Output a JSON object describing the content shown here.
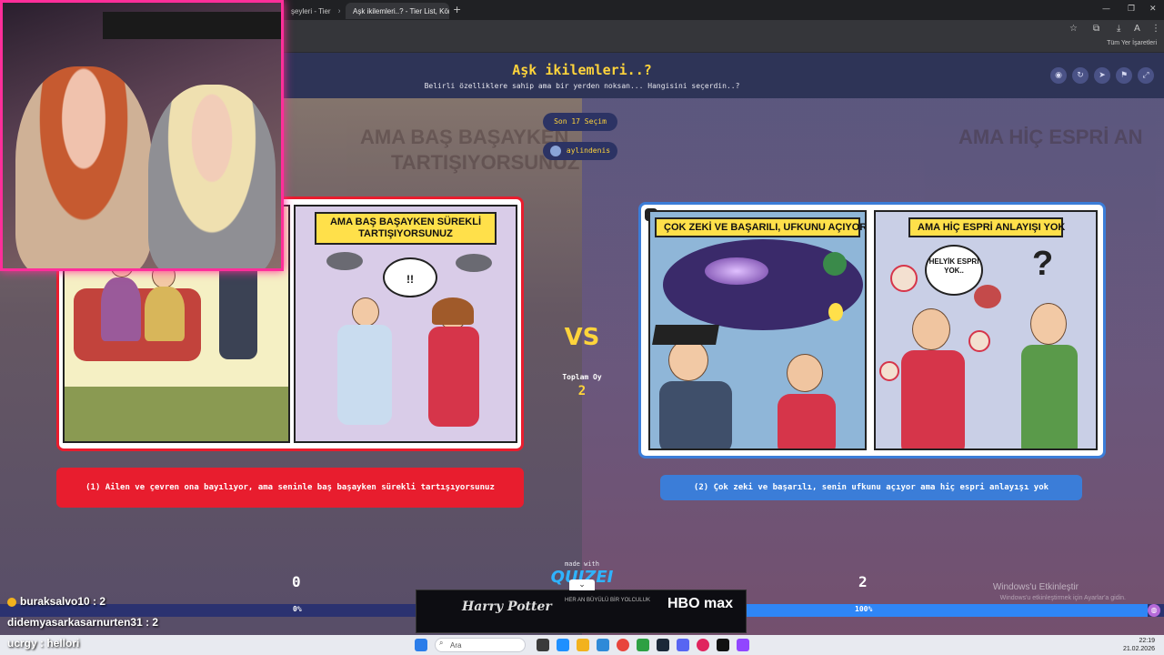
{
  "browser": {
    "tabs": [
      {
        "label": "şeyleri - Tier",
        "active": false
      },
      {
        "label": "Aşk ikilemleri..? - Tier List, Kör",
        "active": true
      }
    ],
    "new_tab": "+",
    "bookmarks_label": "Tüm Yer İşaretleri"
  },
  "page": {
    "title": "Aşk ikilemleri..?",
    "subtitle": "Belirli özelliklere sahip ama bir yerden noksan... Hangisini seçerdin..?",
    "last_choices_pill": "Son 17 Seçim",
    "username_pill": "aylindenis",
    "background_text_left": "AMA BAŞ BAŞAYKEN",
    "background_text_left2": "TARTIŞIYORSUNUZ",
    "background_text_right": "AMA HİÇ ESPRİ AN",
    "vs_label": "VS",
    "total_votes_label": "Toplam Oy",
    "total_votes_value": "2"
  },
  "left_option": {
    "panel2_caption_line1": "AMA BAŞ BAŞAYKEN SÜREKLİ",
    "panel2_caption_line2": "TARTIŞIYORSUNUZ",
    "panel1_bubble": "...",
    "panel2_bubble": "!!",
    "answer_text": "(1) Ailen ve çevren ona bayılıyor, ama seninle baş başayken sürekli tartışıyorsunuz",
    "vote_count": "0",
    "percent": "0%"
  },
  "right_option": {
    "panel1_caption": "ÇOK ZEKİ VE BAŞARILI, UFKUNU AÇIYOR",
    "panel2_caption": "AMA HİÇ ESPRİ ANLAYIŞI YOK",
    "panel2_bubble": "HELYİK ESPRİ YOK..",
    "question_mark": "?",
    "answer_text": "(2) Çok zeki ve başarılı, senin ufkunu açıyor ama hiç espri anlayışı yok",
    "vote_count": "2",
    "percent": "100%"
  },
  "footer": {
    "made_with": "made with",
    "logo": "QUIZEI"
  },
  "progress": {
    "right_fill_fraction": 1.0
  },
  "windows_watermark": {
    "line1": "Windows'u Etkinleştir",
    "line2": "Windows'u etkinleştirmek için Ayarlar'a gidin."
  },
  "ad": {
    "left_brand": "Harry Potter",
    "middle_text": "HER AN BÜYÜLÜ BİR YOLCULUK",
    "right_brand": "HBO max"
  },
  "chat": [
    {
      "user": "buraksalvo10",
      "text": "buraksalvo10 : 2"
    },
    {
      "user": "didemyasarkasarnurten31",
      "text": "didemyasarkasarnurten31 : 2"
    },
    {
      "user": "ucrgy",
      "text": "ucrgy : hellori"
    }
  ],
  "taskbar": {
    "search_placeholder": "Ara",
    "time": "22:19",
    "date": "21.02.2026"
  },
  "colors": {
    "left_accent": "#e81d2e",
    "right_accent": "#3b7dd8",
    "title_yellow": "#ffd43b",
    "cam_border": "#ff2e9a"
  }
}
